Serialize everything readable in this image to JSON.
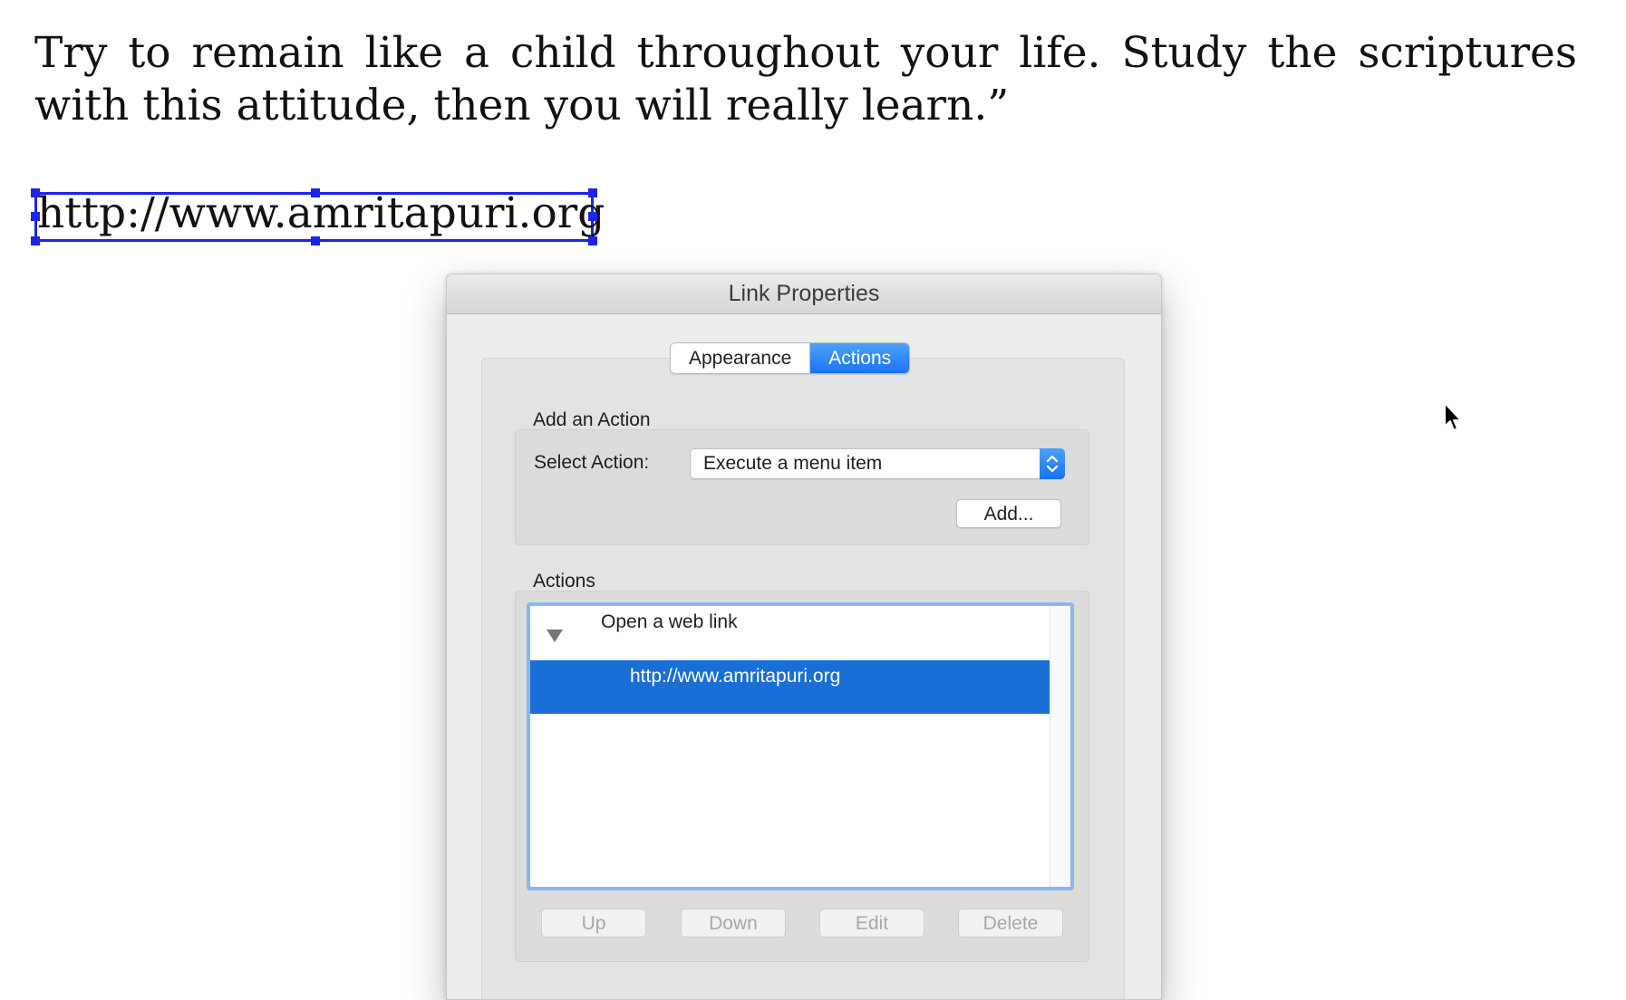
{
  "document": {
    "paragraph": "Try to remain like a child throughout your life. Study the scriptures with this attitude, then you will really learn.”",
    "link_text": "http://www.amritapuri.org"
  },
  "dialog": {
    "title": "Link Properties",
    "tabs": [
      {
        "label": "Appearance",
        "active": false
      },
      {
        "label": "Actions",
        "active": true
      }
    ],
    "add_action": {
      "section_label": "Add an Action",
      "select_label": "Select Action:",
      "selected_value": "Execute a menu item",
      "add_button": "Add..."
    },
    "actions": {
      "section_label": "Actions",
      "tree": [
        {
          "label": "Open a web link",
          "expanded": true,
          "children": [
            {
              "label": "http://www.amritapuri.org",
              "selected": true
            }
          ]
        }
      ],
      "buttons": {
        "up": "Up",
        "down": "Down",
        "edit": "Edit",
        "delete": "Delete"
      }
    }
  },
  "colors": {
    "selection_handles": "#1b24e8",
    "accent": "#1874f2",
    "selected_row": "#1a6fd6"
  },
  "icons": {
    "cursor": "arrow-cursor-icon",
    "select_arrows": "up-down-chevron-icon",
    "tree_toggle": "disclosure-triangle-icon"
  }
}
